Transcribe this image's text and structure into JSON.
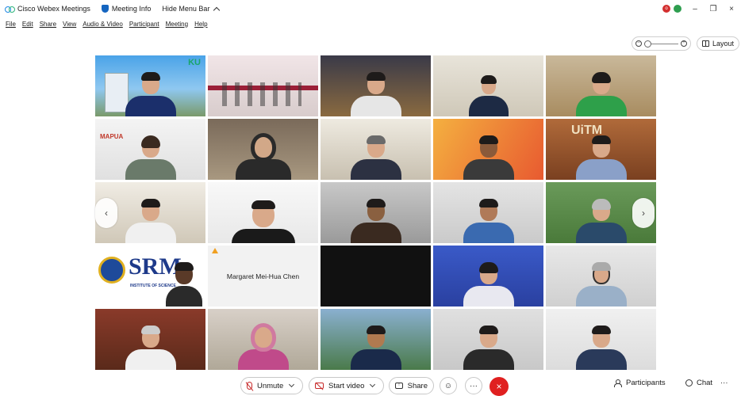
{
  "titlebar": {
    "app_name": "Cisco Webex Meetings",
    "meeting_info": "Meeting Info",
    "hide_menu_bar": "Hide Menu Bar",
    "rec_badge": "o",
    "minimize": "–",
    "restore": "❐",
    "close": "×"
  },
  "menu": [
    "File",
    "Edit",
    "Share",
    "View",
    "Audio & Video",
    "Participant",
    "Meeting",
    "Help"
  ],
  "view_controls": {
    "layout_label": "Layout"
  },
  "tiles": {
    "r1c1_logo": "KU",
    "r2c1_logo": "MAPUA",
    "r2c5_logo": "UiTM",
    "r4c1_logo": "SRM",
    "r4c1_sub": "INSTITUTE OF SCIENCE",
    "r4c2_name": "Margaret Mei-Hua Chen"
  },
  "controls": {
    "unmute": "Unmute",
    "start_video": "Start video",
    "share": "Share",
    "reactions_icon": "☺",
    "more_icon": "···",
    "end_icon": "×",
    "participants": "Participants",
    "chat": "Chat",
    "more_right": "···"
  },
  "colors": {
    "end_red": "#e02020",
    "muted_red": "#c62828",
    "accent_blue": "#1e88e5"
  }
}
